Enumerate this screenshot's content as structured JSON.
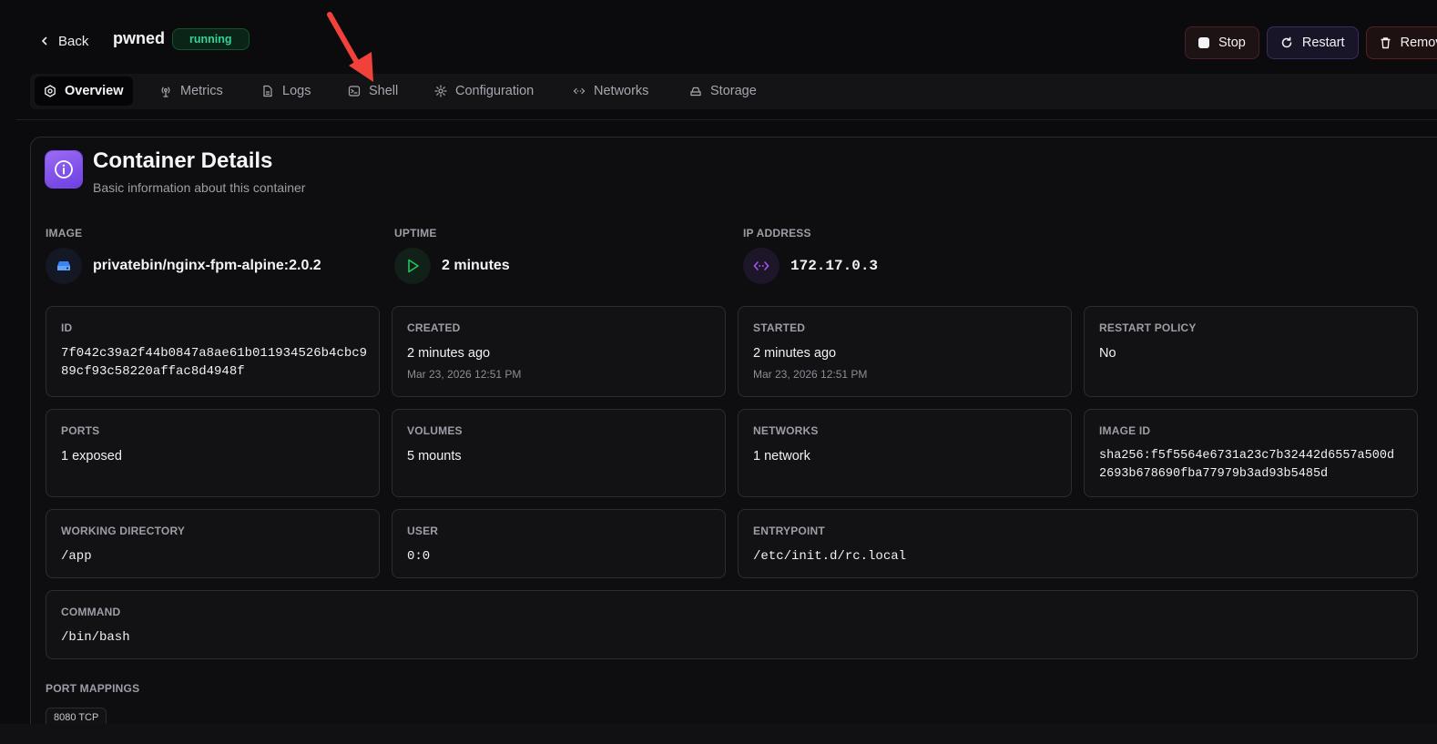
{
  "header": {
    "back_label": "Back",
    "container_name": "pwned",
    "status": "running",
    "actions": {
      "stop": "Stop",
      "restart": "Restart",
      "remove": "Remov"
    }
  },
  "tabs": [
    {
      "label": "Overview",
      "icon": "overview-icon",
      "active": true
    },
    {
      "label": "Metrics",
      "icon": "antenna-icon"
    },
    {
      "label": "Logs",
      "icon": "file-icon"
    },
    {
      "label": "Shell",
      "icon": "terminal-icon"
    },
    {
      "label": "Configuration",
      "icon": "gear-icon"
    },
    {
      "label": "Networks",
      "icon": "network-icon"
    },
    {
      "label": "Storage",
      "icon": "storage-icon"
    }
  ],
  "details": {
    "title": "Container Details",
    "subtitle": "Basic information about this container",
    "image": {
      "label": "IMAGE",
      "value": "privatebin/nginx-fpm-alpine:2.0.2"
    },
    "uptime": {
      "label": "UPTIME",
      "value": "2 minutes"
    },
    "ip": {
      "label": "IP ADDRESS",
      "value": "172.17.0.3"
    },
    "id": {
      "label": "ID",
      "line1": "7f042c39a2f44b0847a8ae61b011934526b4cbc9",
      "line2": "89cf93c58220affac8d4948f"
    },
    "created": {
      "label": "CREATED",
      "value": "2 minutes ago",
      "date": "Mar 23, 2026 12:51 PM"
    },
    "started": {
      "label": "STARTED",
      "value": "2 minutes ago",
      "date": "Mar 23, 2026 12:51 PM"
    },
    "restart_policy": {
      "label": "RESTART POLICY",
      "value": "No"
    },
    "ports": {
      "label": "PORTS",
      "value": "1 exposed"
    },
    "volumes": {
      "label": "VOLUMES",
      "value": "5 mounts"
    },
    "networks": {
      "label": "NETWORKS",
      "value": "1 network"
    },
    "image_id": {
      "label": "IMAGE ID",
      "line1": "sha256:f5f5564e6731a23c7b32442d6557a500d",
      "line2": "2693b678690fba77979b3ad93b5485d"
    },
    "working_dir": {
      "label": "WORKING DIRECTORY",
      "value": "/app"
    },
    "user": {
      "label": "USER",
      "value": "0:0"
    },
    "entrypoint": {
      "label": "ENTRYPOINT",
      "value": "/etc/init.d/rc.local"
    },
    "command": {
      "label": "COMMAND",
      "value": "/bin/bash"
    },
    "port_mappings": {
      "label": "PORT MAPPINGS",
      "chips": [
        "8080 TCP"
      ]
    }
  },
  "colors": {
    "accent": "#7c4ef0",
    "running": "#34d399",
    "annotation_arrow": "#f0413a"
  }
}
